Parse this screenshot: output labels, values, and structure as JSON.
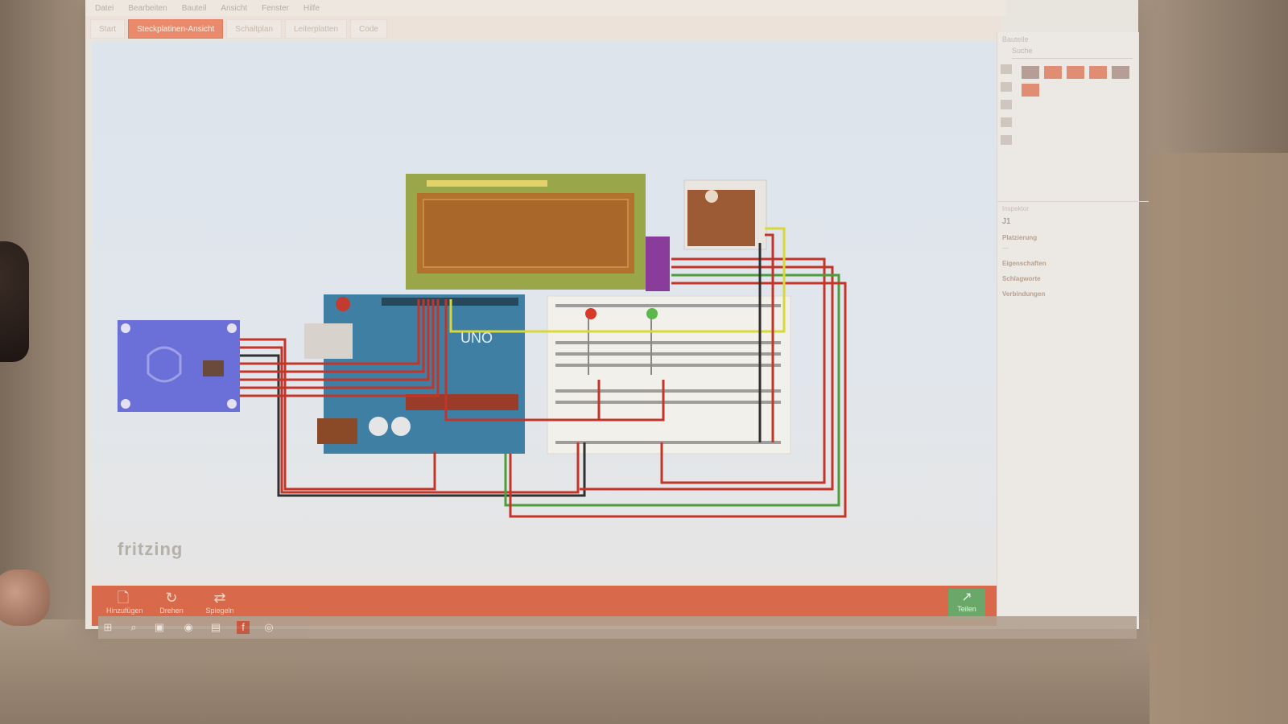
{
  "window": {
    "title": "",
    "menus": [
      "Datei",
      "Bearbeiten",
      "Bauteil",
      "Ansicht",
      "Fenster",
      "Hilfe"
    ]
  },
  "tabs": [
    {
      "label": "Start"
    },
    {
      "label": "Steckplatinen-Ansicht",
      "active": true
    },
    {
      "label": "Schaltplan"
    },
    {
      "label": "Leiterplatten"
    },
    {
      "label": "Code"
    }
  ],
  "canvas": {
    "logo": "fritzing"
  },
  "toolbar": {
    "share_label": "Teilen",
    "tools": [
      {
        "label": "Hinzufügen",
        "icon": "add-note-icon"
      },
      {
        "label": "Drehen",
        "icon": "rotate-icon"
      },
      {
        "label": "Spiegeln",
        "icon": "flip-icon"
      }
    ],
    "hint": "",
    "status": ""
  },
  "dock": {
    "parts_title": "Bauteile",
    "search_placeholder": "Suche",
    "inspector_title": "Inspektor",
    "inspector_part": "J1",
    "sections": [
      "Platzierung",
      "Eigenschaften",
      "Schlagworte",
      "Verbindungen"
    ]
  },
  "taskbar": {
    "clock_time": "",
    "clock_date": "",
    "apps": [
      "windows-start-icon",
      "search-icon",
      "task-view-icon",
      "browser-icon",
      "explorer-icon",
      "fritzing-icon",
      "media-icon"
    ]
  },
  "circuit": {
    "lcd_color": "#b3712e",
    "arduino_color": "#3f7fa3",
    "rfid_color": "#6b6fd8",
    "breadboard_color": "#f2f0ea",
    "wire_red": "#c2362a",
    "wire_green": "#4d9d3a",
    "wire_yellow": "#d8d83a",
    "wire_black": "#303030",
    "arduino_label": "UNO"
  }
}
